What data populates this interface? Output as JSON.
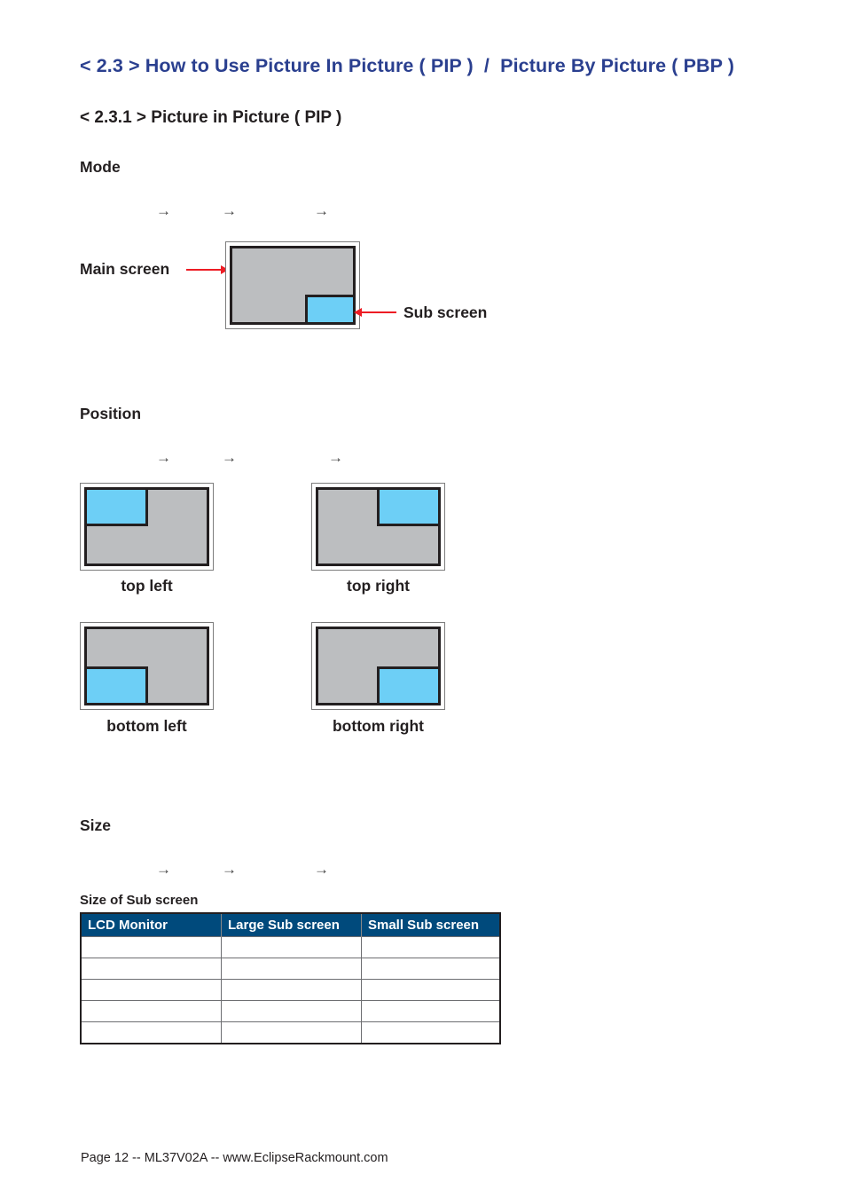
{
  "section_title": "< 2.3 > How to Use Picture In Picture ( PIP )  /  Picture By Picture ( PBP )",
  "subsection_title": "< 2.3.1 > Picture in Picture ( PIP )",
  "mode": {
    "heading": "Mode",
    "arrows": [
      "→",
      "→",
      "→"
    ],
    "diagram": {
      "main_label": "Main screen",
      "sub_label": "Sub screen"
    }
  },
  "position": {
    "heading": "Position",
    "arrows": [
      "→",
      "→",
      "→"
    ],
    "options": [
      {
        "label": "top left",
        "corner": "tl"
      },
      {
        "label": "top right",
        "corner": "tr"
      },
      {
        "label": "bottom left",
        "corner": "bl"
      },
      {
        "label": "bottom right",
        "corner": "br"
      }
    ]
  },
  "size": {
    "heading": "Size",
    "arrows": [
      "→",
      "→",
      "→"
    ],
    "table_caption": "Size of Sub screen",
    "table": {
      "headers": [
        "LCD Monitor",
        "Large Sub screen",
        "Small Sub screen"
      ],
      "rows": [
        [
          "",
          "",
          ""
        ],
        [
          "",
          "",
          ""
        ],
        [
          "",
          "",
          ""
        ],
        [
          "",
          "",
          ""
        ],
        [
          "",
          "",
          ""
        ]
      ]
    }
  },
  "colors": {
    "title_blue": "#2a3f8f",
    "main_screen_gray": "#bcbec0",
    "sub_screen_blue": "#6dcff6",
    "pointer_red": "#ed1c24",
    "table_header": "#004a7c"
  },
  "footer": "Page 12 -- ML37V02A -- www.EclipseRackmount.com"
}
